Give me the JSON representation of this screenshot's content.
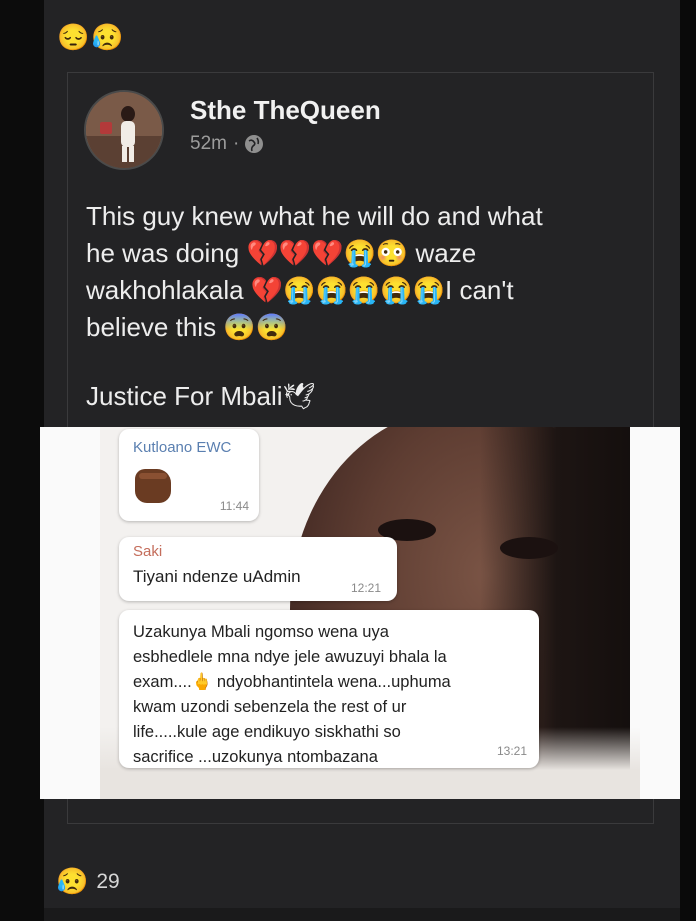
{
  "top_reaction_emojis": "😔😥",
  "post": {
    "author": "Sthe TheQueen",
    "time": "52m",
    "separator": "·",
    "text_lines": [
      "This guy knew what he will do and what",
      "he was doing 💔💔💔😭😳 waze",
      "wakhohlakala 💔😭😭😭😭😭I can't",
      "believe this 😨😨"
    ],
    "justice_line": "Justice For Mbali🕊"
  },
  "chat": {
    "bubble1": {
      "name": "Kutloano EWC",
      "time": "11:44"
    },
    "bubble2": {
      "name": "Saki",
      "message": "Tiyani ndenze uAdmin",
      "time": "12:21"
    },
    "bubble3": {
      "lines": [
        "Uzakunya Mbali ngomso wena uya",
        "esbhedlele mna ndye jele awuzuyi bhala la",
        "exam....🖕 ndyobhantintela wena...uphuma",
        "kwam uzondi sebenzela the rest of ur",
        "life.....kule age endikuyo siskhathi so",
        "sacrifice ...uzokunya ntombazana"
      ],
      "time": "13:21"
    }
  },
  "reactions": {
    "emoji": "😥",
    "count": "29"
  }
}
